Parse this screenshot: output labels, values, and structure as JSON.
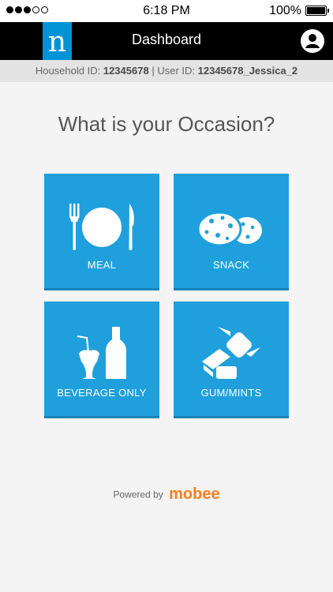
{
  "status_bar": {
    "time": "6:18 PM",
    "battery": "100%",
    "signal_dots_filled": 3,
    "signal_dots_total": 5
  },
  "nav": {
    "logo_letter": "n",
    "title": "Dashboard",
    "profile_icon": "user-circle-icon"
  },
  "ids": {
    "household_label": "Household ID:",
    "household_value": "12345678",
    "separator": "|",
    "user_label": "User ID:",
    "user_value": "12345678_Jessica_2"
  },
  "question": "What is your Occasion?",
  "tiles": [
    {
      "label": "MEAL",
      "icon": "meal-icon"
    },
    {
      "label": "SNACK",
      "icon": "cookies-icon"
    },
    {
      "label": "BEVERAGE ONLY",
      "icon": "beverage-icon"
    },
    {
      "label": "GUM/MINTS",
      "icon": "candy-icon"
    }
  ],
  "footer": {
    "powered_by": "Powered by",
    "brand": "mobee"
  },
  "colors": {
    "tile": "#1fa0dd",
    "logo": "#0093d6",
    "brand": "#f47e21",
    "nav": "#000000"
  }
}
